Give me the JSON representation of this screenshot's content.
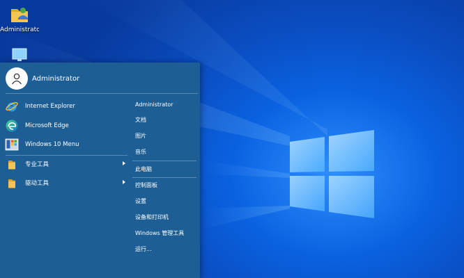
{
  "desktop": {
    "icons": [
      {
        "label": "Administrator",
        "icon": "user-folder-icon"
      },
      {
        "label": "",
        "icon": "computer-icon"
      }
    ]
  },
  "start_menu": {
    "user": {
      "name": "Administrator",
      "icon": "user-avatar-icon"
    },
    "apps": [
      {
        "label": "Internet Explorer",
        "icon": "internet-explorer-icon",
        "submenu": false
      },
      {
        "label": "Microsoft Edge",
        "icon": "edge-icon",
        "submenu": false
      },
      {
        "label": "Windows 10 Menu",
        "icon": "windows-menu-icon",
        "submenu": false
      },
      {
        "label": "专业工具",
        "icon": "folder-icon",
        "submenu": true
      },
      {
        "label": "驱动工具",
        "icon": "folder-icon",
        "submenu": true
      }
    ],
    "places": [
      {
        "label": "Administrator"
      },
      {
        "label": "文档"
      },
      {
        "label": "图片"
      },
      {
        "label": "音乐"
      },
      {
        "label": "此电脑"
      },
      {
        "label": "控制面板"
      },
      {
        "label": "设置"
      },
      {
        "label": "设备和打印机"
      },
      {
        "label": "Windows 管理工具"
      },
      {
        "label": "运行..."
      }
    ]
  },
  "colors": {
    "menu_bg": "#1d5f95",
    "desktop_bg": "#0a5fd8",
    "folder_yellow": "#f3c552"
  }
}
